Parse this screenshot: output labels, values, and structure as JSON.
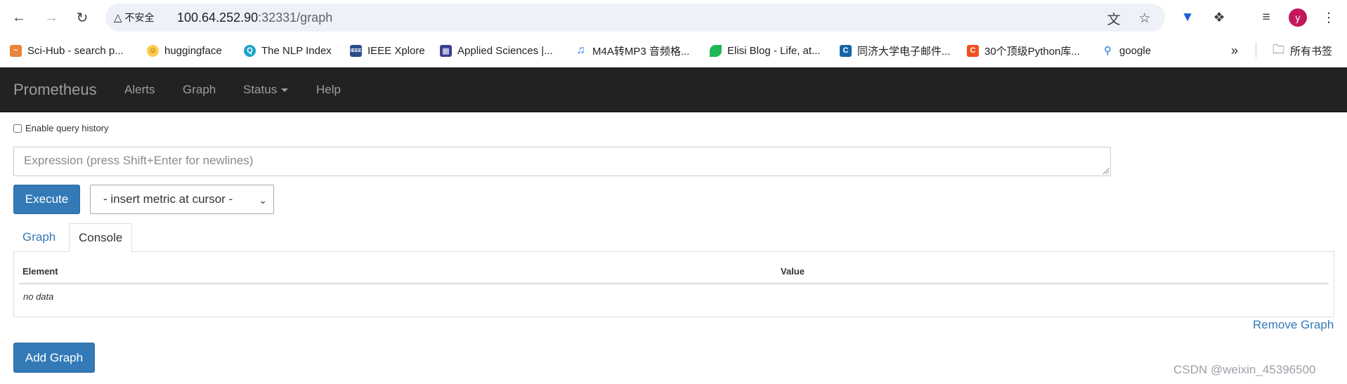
{
  "browser": {
    "security_label": "不安全",
    "url_host": "100.64.252.90",
    "url_rest": ":32331/graph",
    "avatar_letter": "y"
  },
  "bookmarks": [
    {
      "label": "Sci-Hub - search p...",
      "icon": "scihub-icon",
      "color": "#e8833a"
    },
    {
      "label": "huggingface",
      "icon": "hugging-face-icon",
      "color": "#ffcc4d"
    },
    {
      "label": "The NLP Index",
      "icon": "nlp-index-icon",
      "color": "#1aa3c9"
    },
    {
      "label": "IEEE Xplore",
      "icon": "ieee-icon",
      "color": "#2b4d8c"
    },
    {
      "label": "Applied Sciences |...",
      "icon": "mdpi-icon",
      "color": "#3b3f8f"
    },
    {
      "label": "M4A转MP3 音频格...",
      "icon": "music-note-icon",
      "color": "#1a73e8"
    },
    {
      "label": "Elisi Blog - Life, at...",
      "icon": "leaf-icon",
      "color": "#1db954"
    },
    {
      "label": "同济大学电子邮件...",
      "icon": "tongji-icon",
      "color": "#1565a8"
    },
    {
      "label": "30个顶级Python库...",
      "icon": "csdn-icon",
      "color": "#f24e1e"
    },
    {
      "label": "google",
      "icon": "search-icon",
      "color": "#1a73e8"
    }
  ],
  "bookmarks_folder": "所有书签",
  "navbar": {
    "brand": "Prometheus",
    "links": [
      "Alerts",
      "Graph",
      "Status",
      "Help"
    ]
  },
  "query": {
    "history_label": "Enable query history",
    "expression_placeholder": "Expression (press Shift+Enter for newlines)",
    "execute_label": "Execute",
    "metric_select_label": "- insert metric at cursor -"
  },
  "tabs": [
    "Graph",
    "Console"
  ],
  "console_table": {
    "columns": [
      "Element",
      "Value"
    ],
    "empty_text": "no data"
  },
  "remove_graph_label": "Remove Graph",
  "add_graph_label": "Add Graph",
  "watermark": "CSDN @weixin_45396500",
  "colors": {
    "primary": "#337ab7",
    "navbar_bg": "#222222",
    "navbar_text": "#9d9d9d"
  }
}
